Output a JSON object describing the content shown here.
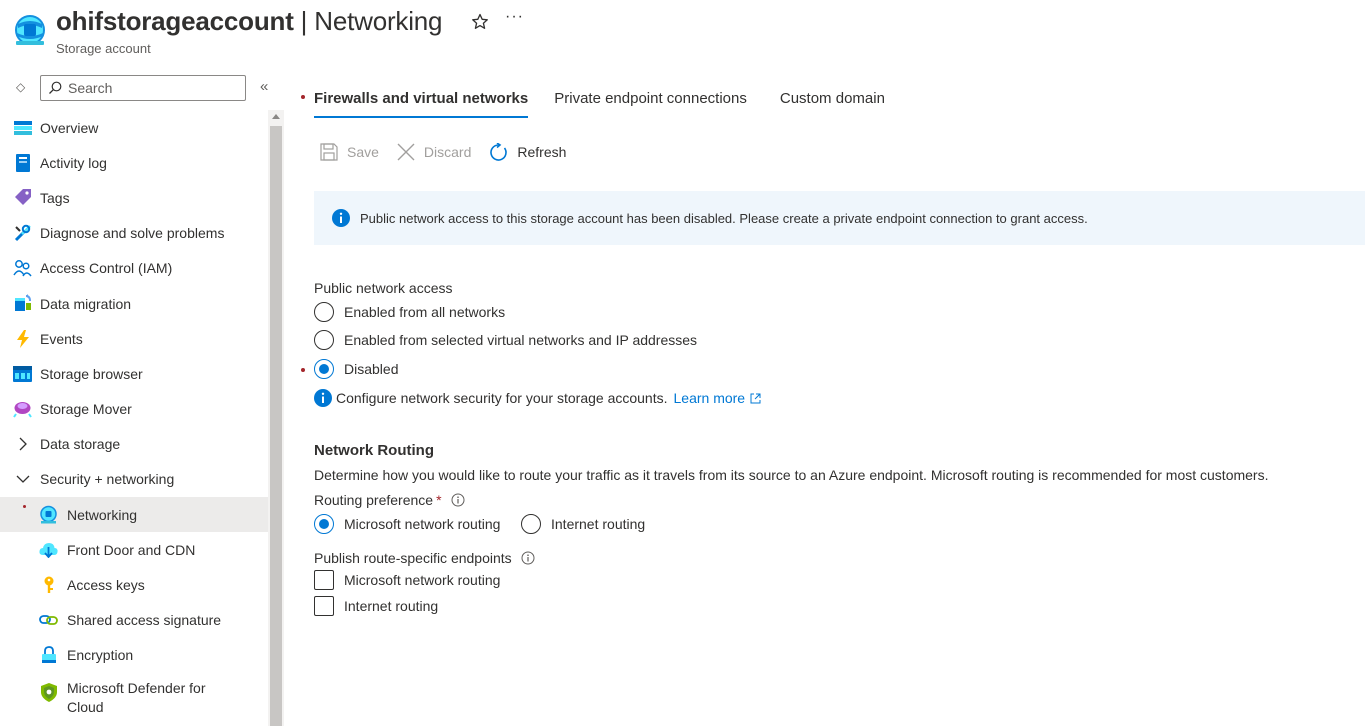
{
  "header": {
    "resource_name": "ohifstorageaccount",
    "separator": " | ",
    "page_name": "Networking",
    "subtitle": "Storage account",
    "more_label": "···"
  },
  "sidebar": {
    "search_placeholder": "Search",
    "collapse_label": "«",
    "sort_label": "◇",
    "items": [
      {
        "label": "Overview",
        "icon": "overview-icon"
      },
      {
        "label": "Activity log",
        "icon": "activity-log-icon"
      },
      {
        "label": "Tags",
        "icon": "tag-icon"
      },
      {
        "label": "Diagnose and solve problems",
        "icon": "wrench-icon"
      },
      {
        "label": "Access Control (IAM)",
        "icon": "people-icon"
      },
      {
        "label": "Data migration",
        "icon": "data-migration-icon"
      },
      {
        "label": "Events",
        "icon": "lightning-icon"
      },
      {
        "label": "Storage browser",
        "icon": "storage-browser-icon"
      },
      {
        "label": "Storage Mover",
        "icon": "storage-mover-icon"
      },
      {
        "label": "Data storage",
        "icon": "chevron-right-icon"
      },
      {
        "label": "Security + networking",
        "icon": "chevron-down-icon"
      },
      {
        "label": "Networking",
        "icon": "networking-icon"
      },
      {
        "label": "Front Door and CDN",
        "icon": "cloud-icon"
      },
      {
        "label": "Access keys",
        "icon": "key-icon"
      },
      {
        "label": "Shared access signature",
        "icon": "link-icon"
      },
      {
        "label": "Encryption",
        "icon": "lock-icon"
      },
      {
        "label": "Microsoft Defender for Cloud",
        "icon": "shield-icon"
      }
    ]
  },
  "tabs": [
    {
      "label": "Firewalls and virtual networks",
      "active": true
    },
    {
      "label": "Private endpoint connections",
      "active": false
    },
    {
      "label": "Custom domain",
      "active": false
    }
  ],
  "toolbar": {
    "save_label": "Save",
    "discard_label": "Discard",
    "refresh_label": "Refresh"
  },
  "banner": {
    "text": "Public network access to this storage account has been disabled. Please create a private endpoint connection to grant access."
  },
  "public_access": {
    "label": "Public network access",
    "options": [
      {
        "label": "Enabled from all networks",
        "selected": false
      },
      {
        "label": "Enabled from selected virtual networks and IP addresses",
        "selected": false
      },
      {
        "label": "Disabled",
        "selected": true
      }
    ],
    "info_text": "Configure network security for your storage accounts.",
    "learn_more": "Learn more"
  },
  "routing": {
    "heading": "Network Routing",
    "description": "Determine how you would like to route your traffic as it travels from its source to an Azure endpoint. Microsoft routing is recommended for most customers.",
    "preference_label": "Routing preference",
    "required_mark": "*",
    "options": [
      {
        "label": "Microsoft network routing",
        "selected": true
      },
      {
        "label": "Internet routing",
        "selected": false
      }
    ],
    "publish_label": "Publish route-specific endpoints",
    "publish_options": [
      {
        "label": "Microsoft network routing",
        "checked": false
      },
      {
        "label": "Internet routing",
        "checked": false
      }
    ]
  },
  "colors": {
    "accent": "#0078d4",
    "required": "#a4262c",
    "banner_bg": "#eff6fc",
    "active_nav_bg": "#ecebea"
  }
}
